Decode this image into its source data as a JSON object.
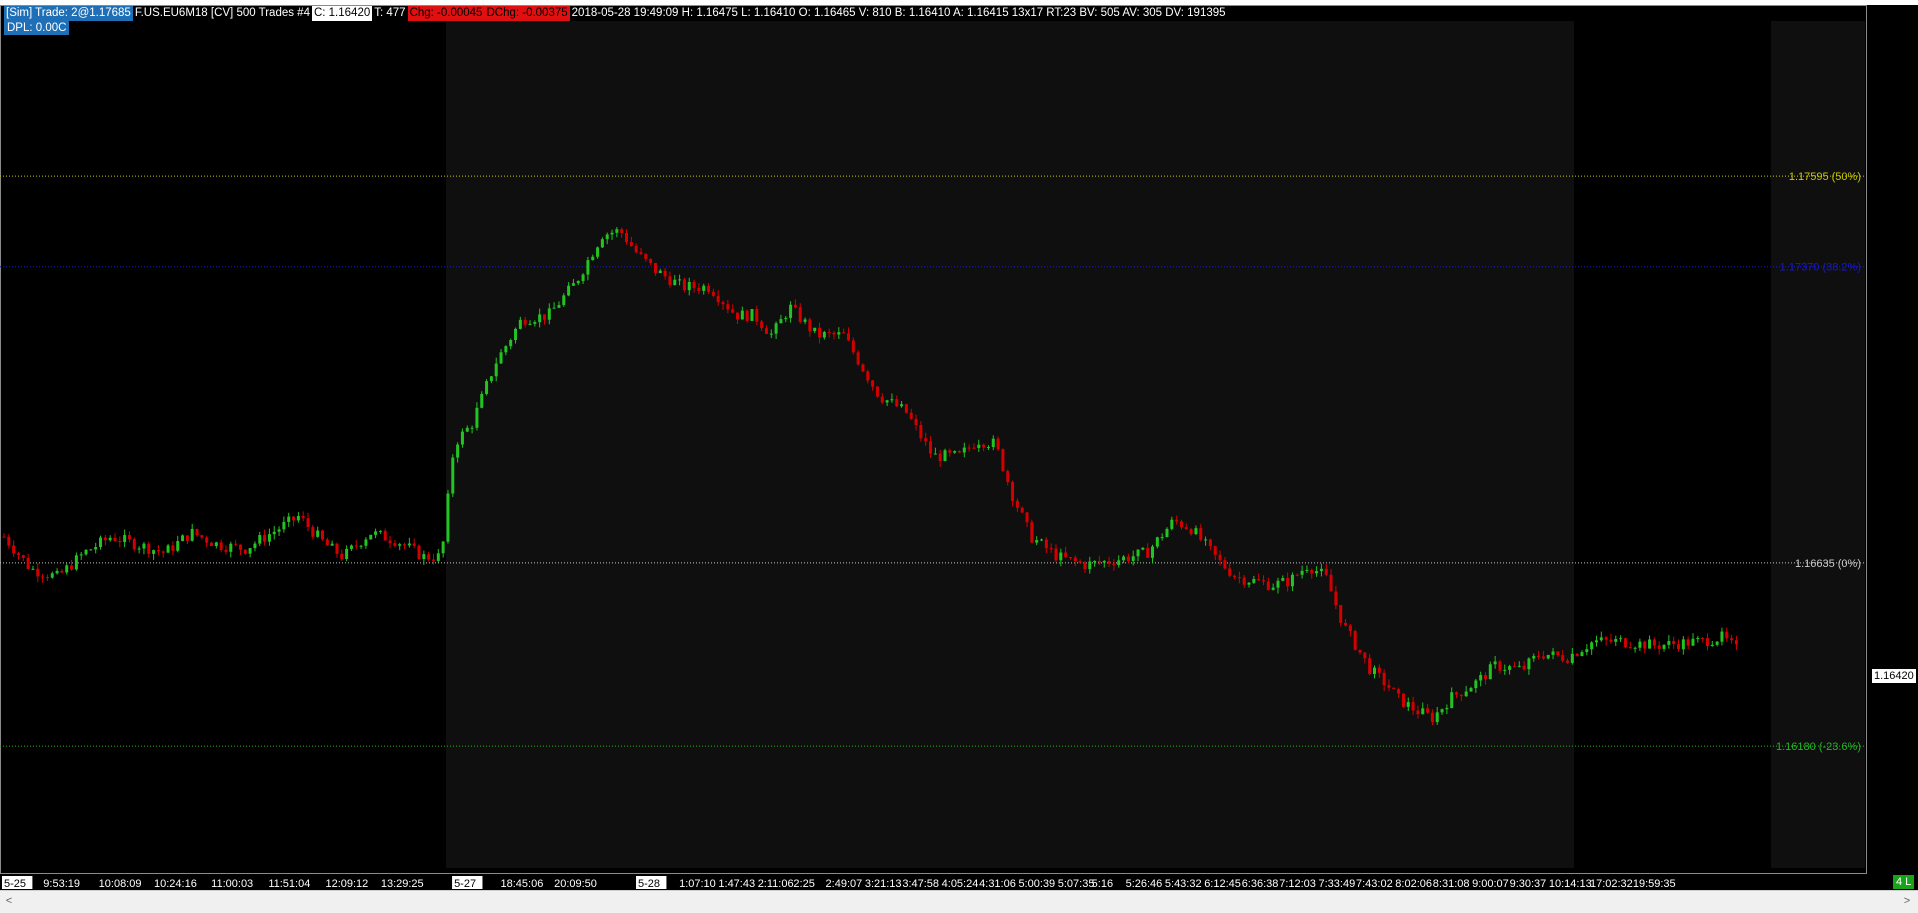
{
  "header": {
    "sim_trade": "[Sim]  Trade: 2@1.17685",
    "instrument": "F.US.EU6M18 [CV]  500 Trades  #4",
    "close": "C: 1.16420",
    "ticks": "T: 477",
    "chg": "Chg: -0.00045",
    "dchg": "DChg: -0.00375",
    "stats": "2018-05-28 19:49:09 H: 1.16475 L: 1.16410 O: 1.16465 V: 810 B: 1.16410 A: 1.16415 13x17 RT:23 BV: 505 AV: 305 DV: 191395",
    "dpl": "DPL: 0.00C"
  },
  "price_tag": "1.16420",
  "badge": "4 L",
  "scrollbar": {
    "left": "<",
    "right": ">"
  },
  "colors": {
    "up": "#22c422",
    "down": "#d40000",
    "fib50": "#c8c800",
    "fib382": "#1a1ac8",
    "fib0": "#c8c8c8",
    "fibneg": "#22b822",
    "session_shade": "#0f0f0f"
  },
  "chart_data": {
    "type": "candlestick",
    "y_range": [
      1.1588,
      1.1798
    ],
    "fib_levels": [
      {
        "price": 1.17595,
        "label": "1.17595  (50%)",
        "color": "#c8c800"
      },
      {
        "price": 1.1737,
        "label": "1.17370  (38.2%)",
        "color": "#1a1ac8"
      },
      {
        "price": 1.16635,
        "label": "1.16635  (0%)",
        "color": "#c8c8c8"
      },
      {
        "price": 1.1618,
        "label": "1.16180  (-23.6%)",
        "color": "#22b822"
      }
    ],
    "time_labels": [
      {
        "t": 0.0,
        "label": "5-25",
        "marker": true
      },
      {
        "t": 0.022,
        "label": "9:53:19"
      },
      {
        "t": 0.053,
        "label": "10:08:09"
      },
      {
        "t": 0.084,
        "label": "10:24:16"
      },
      {
        "t": 0.116,
        "label": "11:00:03"
      },
      {
        "t": 0.148,
        "label": "11:51:04"
      },
      {
        "t": 0.18,
        "label": "12:09:12"
      },
      {
        "t": 0.211,
        "label": "13:29:25"
      },
      {
        "t": 0.252,
        "label": "5-27",
        "marker": true
      },
      {
        "t": 0.278,
        "label": "18:45:06"
      },
      {
        "t": 0.308,
        "label": "20:09:50"
      },
      {
        "t": 0.355,
        "label": "5-28",
        "marker": true
      },
      {
        "t": 0.378,
        "label": "1:07:10"
      },
      {
        "t": 0.4,
        "label": "1:47:43"
      },
      {
        "t": 0.422,
        "label": "2:11:06"
      },
      {
        "t": 0.442,
        "label": "2:25"
      },
      {
        "t": 0.46,
        "label": "2:49:07"
      },
      {
        "t": 0.482,
        "label": "3:21:13"
      },
      {
        "t": 0.503,
        "label": "3:47:58"
      },
      {
        "t": 0.525,
        "label": "4:05:24"
      },
      {
        "t": 0.546,
        "label": "4:31:06"
      },
      {
        "t": 0.568,
        "label": "5:00:39"
      },
      {
        "t": 0.59,
        "label": "5:07:35"
      },
      {
        "t": 0.609,
        "label": "5:16"
      },
      {
        "t": 0.628,
        "label": "5:26:46"
      },
      {
        "t": 0.65,
        "label": "5:43:32"
      },
      {
        "t": 0.672,
        "label": "6:12:45"
      },
      {
        "t": 0.693,
        "label": "6:36:38"
      },
      {
        "t": 0.714,
        "label": "7:12:03"
      },
      {
        "t": 0.736,
        "label": "7:33:49"
      },
      {
        "t": 0.757,
        "label": "7:43:02"
      },
      {
        "t": 0.779,
        "label": "8:02:06"
      },
      {
        "t": 0.8,
        "label": "8:31:08"
      },
      {
        "t": 0.822,
        "label": "9:00:07"
      },
      {
        "t": 0.843,
        "label": "9:30:37"
      },
      {
        "t": 0.865,
        "label": "10:14:13"
      },
      {
        "t": 0.888,
        "label": "17:02:32"
      },
      {
        "t": 0.912,
        "label": "19:59:35"
      }
    ],
    "trend_path": [
      [
        0.0,
        1.167
      ],
      [
        0.015,
        1.1662
      ],
      [
        0.03,
        1.166
      ],
      [
        0.045,
        1.1666
      ],
      [
        0.06,
        1.167
      ],
      [
        0.075,
        1.1668
      ],
      [
        0.09,
        1.1666
      ],
      [
        0.105,
        1.1671
      ],
      [
        0.12,
        1.1668
      ],
      [
        0.135,
        1.1667
      ],
      [
        0.15,
        1.1671
      ],
      [
        0.165,
        1.1675
      ],
      [
        0.18,
        1.1668
      ],
      [
        0.19,
        1.1665
      ],
      [
        0.205,
        1.1671
      ],
      [
        0.22,
        1.1669
      ],
      [
        0.235,
        1.1665
      ],
      [
        0.245,
        1.1665
      ],
      [
        0.252,
        1.1693
      ],
      [
        0.262,
        1.1698
      ],
      [
        0.275,
        1.1713
      ],
      [
        0.29,
        1.1724
      ],
      [
        0.305,
        1.1725
      ],
      [
        0.32,
        1.1733
      ],
      [
        0.335,
        1.1745
      ],
      [
        0.345,
        1.1746
      ],
      [
        0.355,
        1.174
      ],
      [
        0.365,
        1.1736
      ],
      [
        0.38,
        1.1732
      ],
      [
        0.395,
        1.1732
      ],
      [
        0.41,
        1.1725
      ],
      [
        0.42,
        1.1725
      ],
      [
        0.43,
        1.172
      ],
      [
        0.44,
        1.1727
      ],
      [
        0.455,
        1.172
      ],
      [
        0.47,
        1.172
      ],
      [
        0.49,
        1.1705
      ],
      [
        0.505,
        1.1701
      ],
      [
        0.52,
        1.169
      ],
      [
        0.535,
        1.169
      ],
      [
        0.545,
        1.1694
      ],
      [
        0.555,
        1.1693
      ],
      [
        0.565,
        1.168
      ],
      [
        0.575,
        1.167
      ],
      [
        0.59,
        1.1665
      ],
      [
        0.605,
        1.1663
      ],
      [
        0.62,
        1.1664
      ],
      [
        0.63,
        1.1665
      ],
      [
        0.64,
        1.1666
      ],
      [
        0.655,
        1.1674
      ],
      [
        0.665,
        1.1672
      ],
      [
        0.68,
        1.1664
      ],
      [
        0.69,
        1.166
      ],
      [
        0.7,
        1.1659
      ],
      [
        0.71,
        1.1658
      ],
      [
        0.72,
        1.1659
      ],
      [
        0.73,
        1.1663
      ],
      [
        0.74,
        1.166
      ],
      [
        0.75,
        1.1648
      ],
      [
        0.765,
        1.1637
      ],
      [
        0.775,
        1.1633
      ],
      [
        0.78,
        1.163
      ],
      [
        0.79,
        1.1627
      ],
      [
        0.8,
        1.1625
      ],
      [
        0.81,
        1.163
      ],
      [
        0.825,
        1.1634
      ],
      [
        0.835,
        1.1638
      ],
      [
        0.85,
        1.1637
      ],
      [
        0.86,
        1.1641
      ],
      [
        0.875,
        1.164
      ],
      [
        0.89,
        1.1644
      ],
      [
        0.905,
        1.1644
      ],
      [
        0.925,
        1.1643
      ],
      [
        0.95,
        1.1644
      ],
      [
        0.962,
        1.1645
      ],
      [
        0.97,
        1.1642
      ]
    ]
  }
}
